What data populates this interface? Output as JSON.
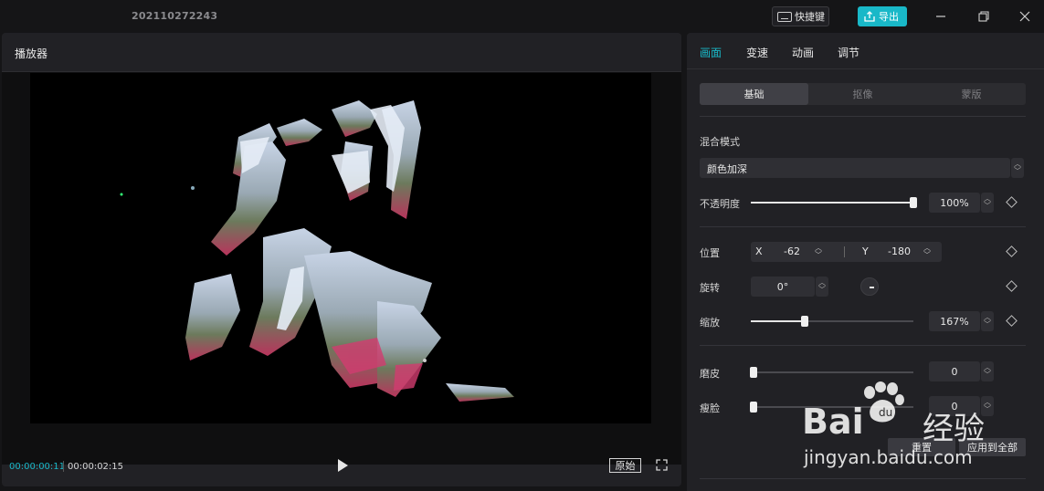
{
  "app": {
    "title": "202110272243"
  },
  "toolbar": {
    "shortcut_label": "快捷键",
    "export_label": "导出"
  },
  "window": {
    "minimize": "—",
    "maximize": "❐",
    "close": "✕"
  },
  "player": {
    "title": "播放器",
    "current_time": "00:00:00:11",
    "total_time": "00:00:02:15",
    "original_label": "原始",
    "video_text": "人间烟火"
  },
  "panel": {
    "tabs": [
      "画面",
      "变速",
      "动画",
      "调节"
    ],
    "active_tab": "画面",
    "subtabs": [
      "基础",
      "抠像",
      "蒙版"
    ],
    "active_subtab": "基础",
    "blend_mode_label": "混合模式",
    "blend_mode_value": "颜色加深",
    "opacity_label": "不透明度",
    "opacity_value": "100%",
    "opacity_level": 1.0,
    "position_label": "位置",
    "pos_x_label": "X",
    "pos_x_value": "-62",
    "pos_y_label": "Y",
    "pos_y_value": "-180",
    "rotation_label": "旋转",
    "rotation_value": "0°",
    "scale_label": "缩放",
    "scale_value": "167%",
    "scale_level": 0.33,
    "smooth_label": "磨皮",
    "smooth_value": "0",
    "slim_label": "瘦脸",
    "slim_value": "0",
    "reset_label": "重置",
    "apply_all_label": "应用到全部"
  },
  "watermark": {
    "brand": "Bai",
    "brand2": "经验",
    "url": "jingyan.baidu.com"
  },
  "colors": {
    "accent": "#19b8c8",
    "panel_bg": "#212125",
    "app_bg": "#151517"
  }
}
